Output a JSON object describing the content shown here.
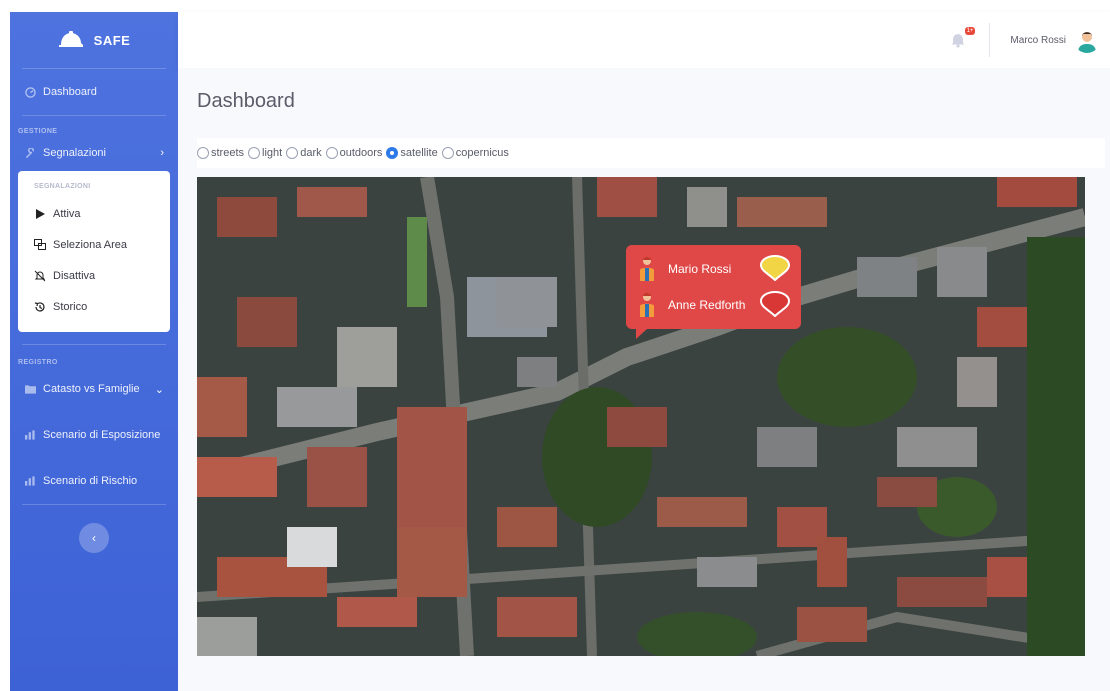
{
  "app": {
    "brand": "SAFE"
  },
  "sidebar": {
    "dashboard_label": "Dashboard",
    "gestione_heading": "GESTIONE",
    "segnalazioni_label": "Segnalazioni",
    "submenu": {
      "heading": "SEGNALAZIONI",
      "items": [
        {
          "label": "Attiva",
          "icon": "play-icon"
        },
        {
          "label": "Seleziona Area",
          "icon": "select-area-icon"
        },
        {
          "label": "Disattiva",
          "icon": "bell-slash-icon"
        },
        {
          "label": "Storico",
          "icon": "history-icon"
        }
      ]
    },
    "registro_heading": "REGISTRO",
    "catasto_label": "Catasto vs Famiglie",
    "esposizione_label": "Scenario di Esposizione",
    "rischio_label": "Scenario di Rischio",
    "toggle_glyph": "‹"
  },
  "topbar": {
    "notification_badge": "1+",
    "user_name": "Marco Rossi"
  },
  "main": {
    "page_title": "Dashboard",
    "layers": [
      {
        "label": "streets",
        "selected": false
      },
      {
        "label": "light",
        "selected": false
      },
      {
        "label": "dark",
        "selected": false
      },
      {
        "label": "outdoors",
        "selected": false
      },
      {
        "label": "satellite",
        "selected": true
      },
      {
        "label": "copernicus",
        "selected": false
      }
    ],
    "popup": {
      "entries": [
        {
          "name": "Mario Rossi",
          "marker_color": "#f2d544"
        },
        {
          "name": "Anne Redforth",
          "marker_color": "#d93636"
        }
      ]
    }
  },
  "colors": {
    "sidebar": "#4e73df",
    "popup": "#e04848",
    "radio_selected": "#2e7be8"
  }
}
